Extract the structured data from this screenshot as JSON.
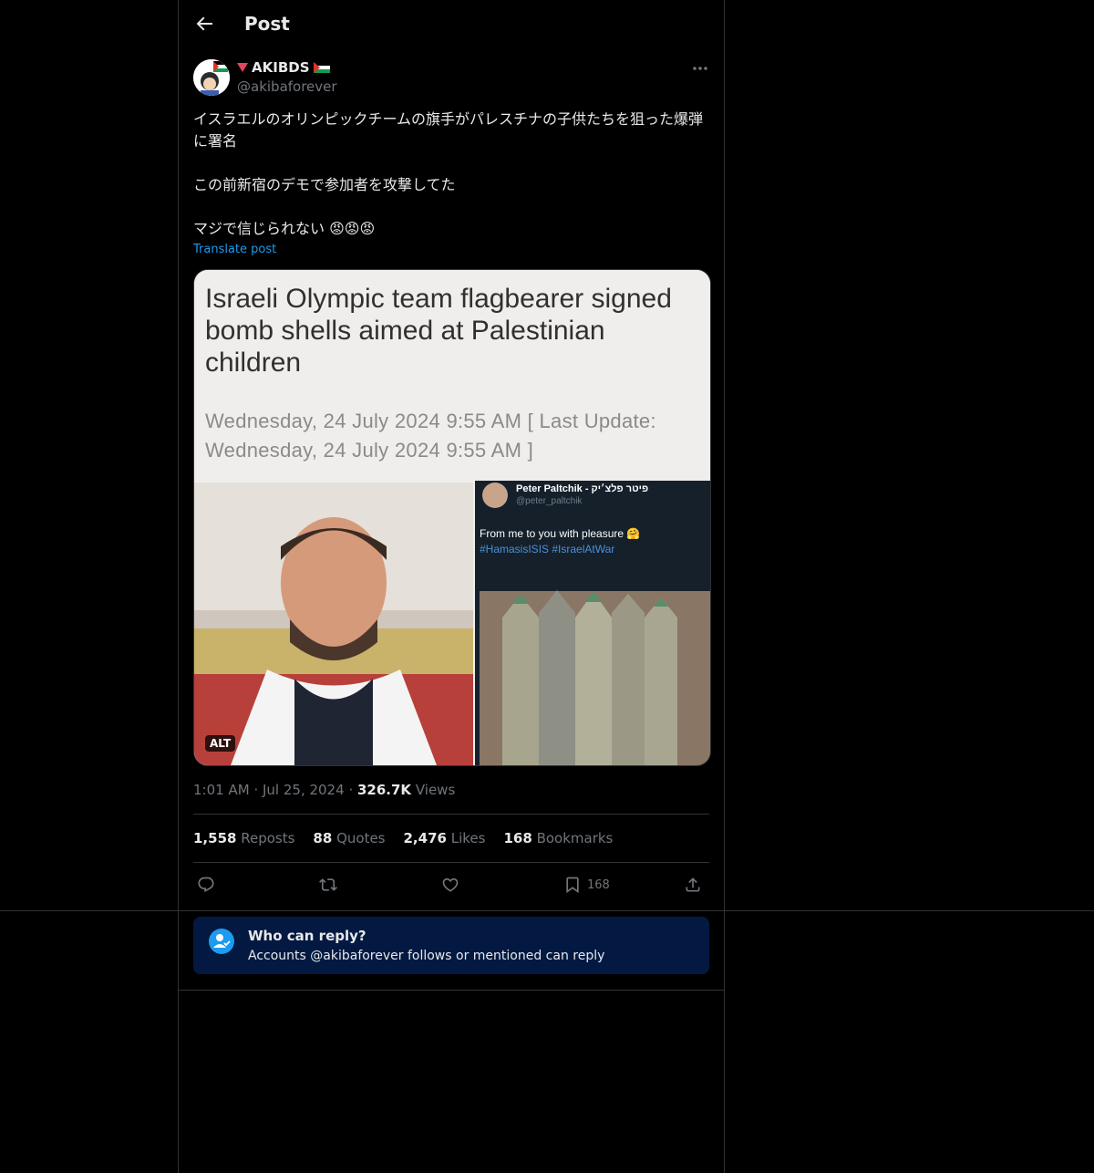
{
  "header": {
    "title": "Post"
  },
  "post": {
    "display_name": "AKIBDS",
    "handle": "@akibaforever",
    "lines": [
      "イスラエルのオリンピックチームの旗手がパレスチナの子供たちを狙った爆弾に署名",
      "この前新宿のデモで参加者を攻撃してた",
      "マジで信じられない 😡😡😡"
    ],
    "translate_label": "Translate post",
    "media": {
      "headline": "Israeli Olympic team flagbearer signed bomb shells aimed at Palestinian children",
      "date_line": "Wednesday, 24 July 2024 9:55 AM  [ Last Update: Wednesday, 24 July 2024 9:55 AM ]",
      "embedded_tweet_name": "Peter Paltchik - פיטר פלצ׳יק",
      "embedded_tweet_handle": "@peter_paltchik",
      "embedded_tweet_text": "From me to you with pleasure 🤗",
      "embedded_tweet_tags": "#HamasisISIS #IsraelAtWar",
      "alt_badge": "ALT"
    },
    "time": "1:01 AM",
    "date": "Jul 25, 2024",
    "views_count": "326.7K",
    "views_label": "Views",
    "stats": {
      "reposts_count": "1,558",
      "reposts_label": "Reposts",
      "quotes_count": "88",
      "quotes_label": "Quotes",
      "likes_count": "2,476",
      "likes_label": "Likes",
      "bookmarks_count": "168",
      "bookmarks_label": "Bookmarks"
    },
    "actions": {
      "bookmark_count": "168"
    }
  },
  "reply_restriction": {
    "title": "Who can reply?",
    "subtitle": "Accounts @akibaforever follows or mentioned can reply"
  },
  "colors": {
    "accent": "#1d9bf0",
    "background": "#000000",
    "reply_box": "#031942"
  },
  "icons": [
    "back-arrow-icon",
    "more-icon",
    "reply-icon",
    "repost-icon",
    "like-icon",
    "bookmark-icon",
    "share-icon",
    "person-check-icon"
  ]
}
